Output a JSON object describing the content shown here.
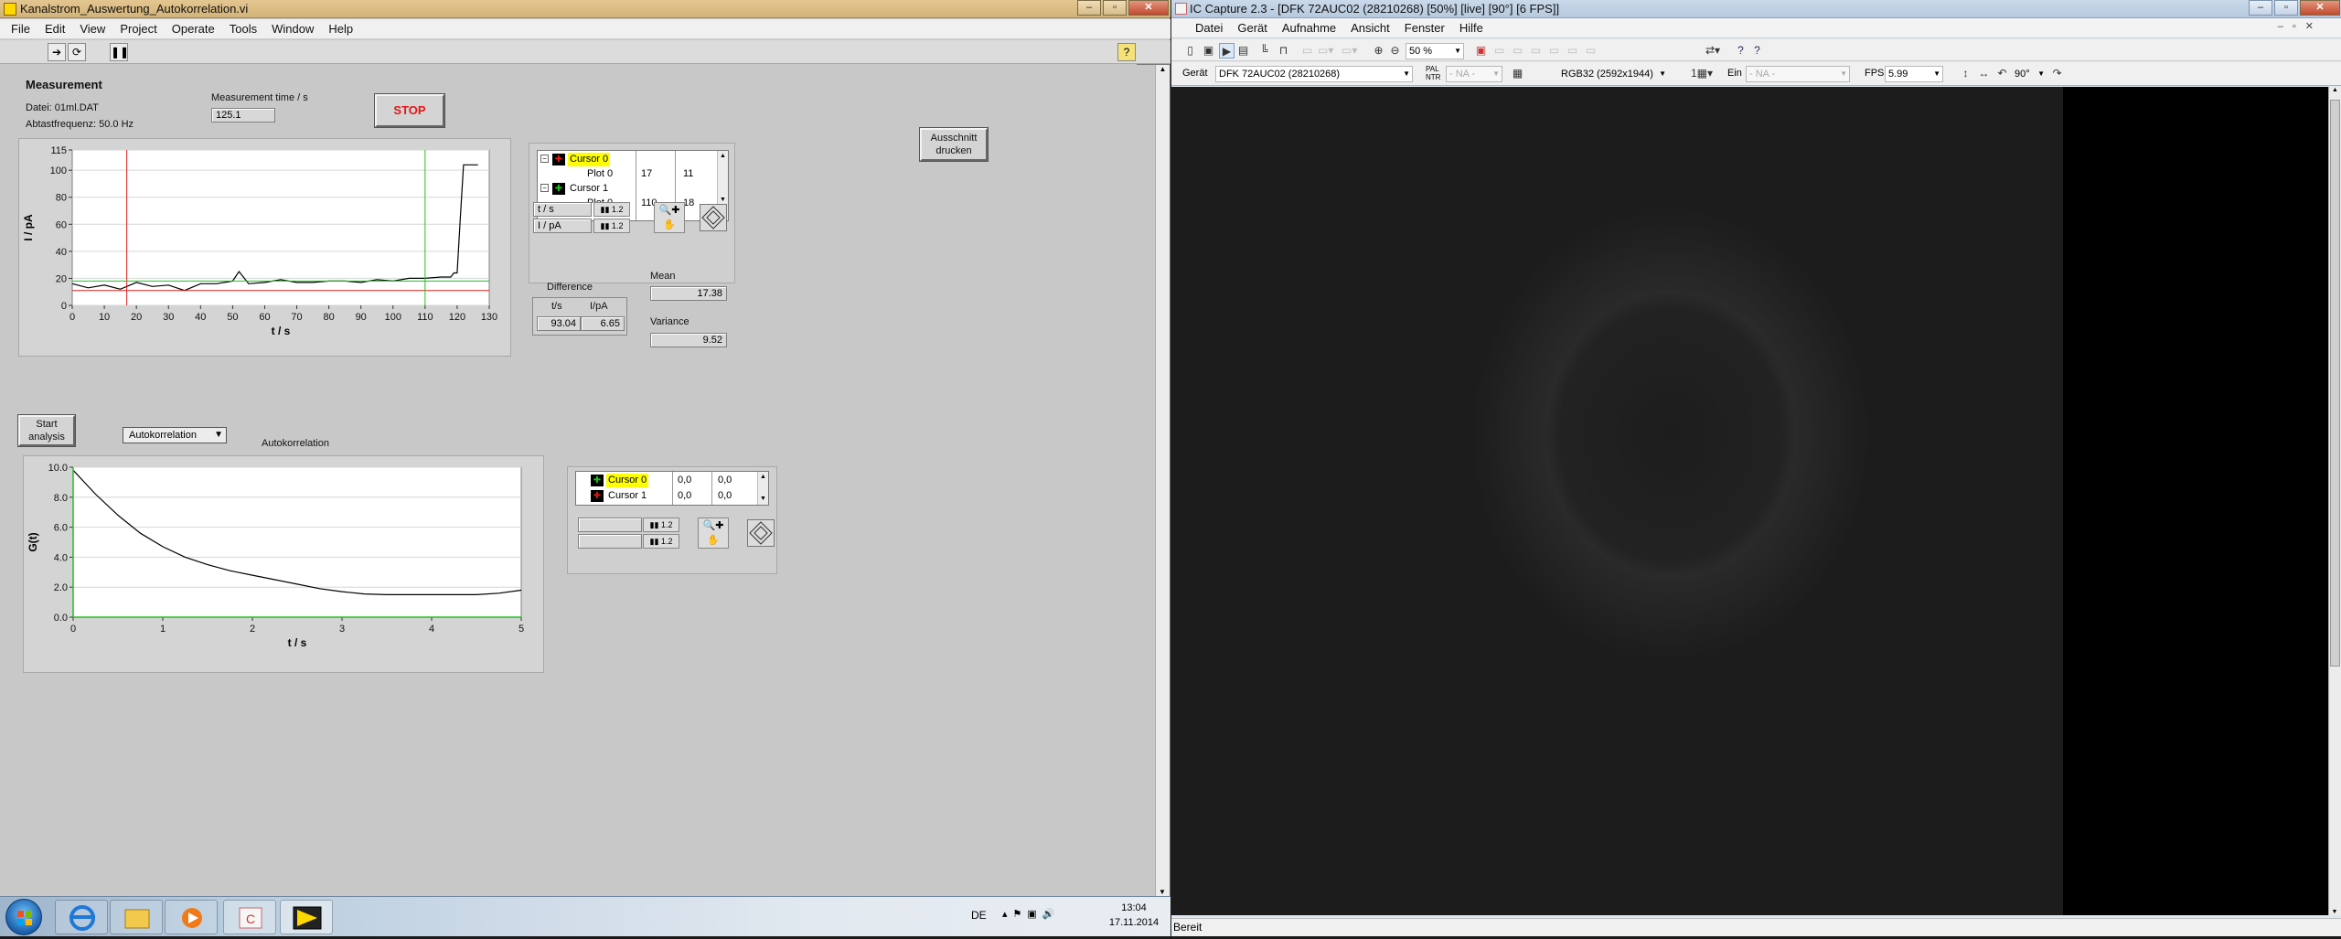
{
  "labview": {
    "title": "Kanalstrom_Auswertung_Autokorrelation.vi",
    "menu": [
      "File",
      "Edit",
      "View",
      "Project",
      "Operate",
      "Tools",
      "Window",
      "Help"
    ],
    "measurement": {
      "heading": "Measurement",
      "file_label": "Datei: 01ml.DAT",
      "freq_label": "Abtastfrequenz: 50.0 Hz",
      "time_label": "Measurement time / s",
      "time_value": "125.1",
      "stop_label": "STOP",
      "print_label_1": "Ausschnitt",
      "print_label_2": "drucken"
    },
    "graph1": {
      "ylabel": "I / pA",
      "xlabel": "t / s",
      "yticks": [
        "115",
        "100",
        "80",
        "60",
        "40",
        "20",
        "0"
      ],
      "xticks": [
        "0",
        "10",
        "20",
        "30",
        "40",
        "50",
        "60",
        "70",
        "80",
        "90",
        "100",
        "110",
        "120",
        "130"
      ]
    },
    "cursors1": {
      "rows": [
        {
          "name": "Cursor 0",
          "plot": "Plot 0",
          "x": "17",
          "y": "11"
        },
        {
          "name": "Cursor 1",
          "plot": "Plot 0",
          "x": "110",
          "y": "18"
        }
      ]
    },
    "scale_legend": {
      "x": "t / s",
      "y": "I / pA"
    },
    "difference": {
      "heading": "Difference",
      "col_t": "t/s",
      "col_i": "I/pA",
      "t": "93.04",
      "i": "6.65"
    },
    "mean": {
      "label": "Mean",
      "value": "17.38"
    },
    "variance": {
      "label": "Variance",
      "value": "9.52"
    },
    "analysis": {
      "start_label_1": "Start",
      "start_label_2": "analysis",
      "mode": "Autokorrelation",
      "graph_title": "Autokorrelation"
    },
    "graph2": {
      "ylabel": "G(t)",
      "xlabel": "t / s",
      "yticks": [
        "10.0",
        "8.0",
        "6.0",
        "4.0",
        "2.0",
        "0.0"
      ],
      "xticks": [
        "0",
        "1",
        "2",
        "3",
        "4",
        "5"
      ]
    },
    "cursors2": {
      "rows": [
        {
          "name": "Cursor 0",
          "x": "0,0",
          "y": "0,0"
        },
        {
          "name": "Cursor 1",
          "x": "0,0",
          "y": "0,0"
        }
      ]
    }
  },
  "ic_capture": {
    "title": "IC Capture 2.3 - [DFK 72AUC02 (28210268) [50%] [live] [90°] [6 FPS]]",
    "menu": [
      "Datei",
      "Gerät",
      "Aufnahme",
      "Ansicht",
      "Fenster",
      "Hilfe"
    ],
    "zoom": "50 %",
    "device_label": "Gerät",
    "device": "DFK 72AUC02 (28210268)",
    "pal_label_1": "PAL",
    "pal_label_2": "NTR",
    "na_1": "- NA -",
    "format": "RGB32 (2592x1944)",
    "input_label": "Ein",
    "na_2": "- NA -",
    "fps_label": "FPS",
    "fps": "5.99",
    "rotation": "90°",
    "status": "Bereit"
  },
  "taskbar": {
    "lang": "DE",
    "time": "13:04",
    "date": "17.11.2014"
  },
  "chart_data": [
    {
      "type": "line",
      "title": "",
      "xlabel": "t / s",
      "ylabel": "I / pA",
      "xlim": [
        0,
        130
      ],
      "ylim": [
        0,
        115
      ],
      "series": [
        {
          "x": [
            0,
            5,
            10,
            15,
            20,
            25,
            30,
            35,
            40,
            45,
            50,
            52,
            55,
            60,
            65,
            70,
            75,
            80,
            85,
            90,
            95,
            100,
            105,
            110,
            115,
            118,
            119,
            120,
            121,
            122,
            125,
            126.5
          ],
          "y": [
            16,
            13,
            15,
            12,
            17,
            14,
            15,
            11,
            16,
            16,
            18,
            25,
            16,
            17,
            19,
            17,
            17,
            18,
            18,
            17,
            19,
            18,
            20,
            20,
            21,
            21,
            24,
            24,
            65,
            104,
            104,
            104
          ]
        }
      ],
      "cursors": [
        {
          "x": 17,
          "y": 11
        },
        {
          "x": 110,
          "y": 18
        }
      ]
    },
    {
      "type": "line",
      "title": "Autokorrelation",
      "xlabel": "t / s",
      "ylabel": "G(t)",
      "xlim": [
        0,
        5
      ],
      "ylim": [
        0,
        10
      ],
      "series": [
        {
          "x": [
            0,
            0.25,
            0.5,
            0.75,
            1,
            1.25,
            1.5,
            1.75,
            2,
            2.25,
            2.5,
            2.75,
            3,
            3.25,
            3.5,
            3.75,
            4,
            4.25,
            4.5,
            4.75,
            5
          ],
          "y": [
            9.8,
            8.2,
            6.8,
            5.6,
            4.7,
            4.0,
            3.5,
            3.1,
            2.8,
            2.5,
            2.2,
            1.9,
            1.7,
            1.55,
            1.5,
            1.5,
            1.5,
            1.5,
            1.5,
            1.6,
            1.8
          ]
        }
      ]
    }
  ]
}
